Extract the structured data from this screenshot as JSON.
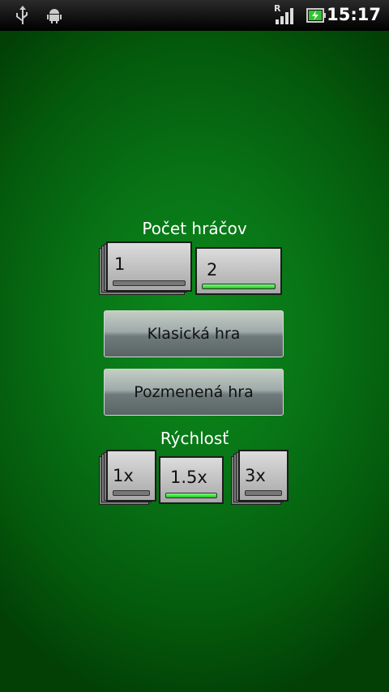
{
  "status": {
    "time": "15:17",
    "icons": [
      "usb-icon",
      "android-icon",
      "signal-icon",
      "battery-charging-icon"
    ],
    "roaming_letter": "R"
  },
  "players": {
    "label": "Počet hráčov",
    "options": [
      {
        "label": "1",
        "selected": false
      },
      {
        "label": "2",
        "selected": true
      }
    ]
  },
  "buttons": {
    "classic": "Klasická hra",
    "modified": "Pozmenená hra"
  },
  "speed": {
    "label": "Rýchlosť",
    "options": [
      {
        "label": "1x",
        "selected": false
      },
      {
        "label": "1.5x",
        "selected": true
      },
      {
        "label": "3x",
        "selected": false
      }
    ]
  },
  "colors": {
    "background": "#087416",
    "active_bar": "#2fd12f"
  }
}
